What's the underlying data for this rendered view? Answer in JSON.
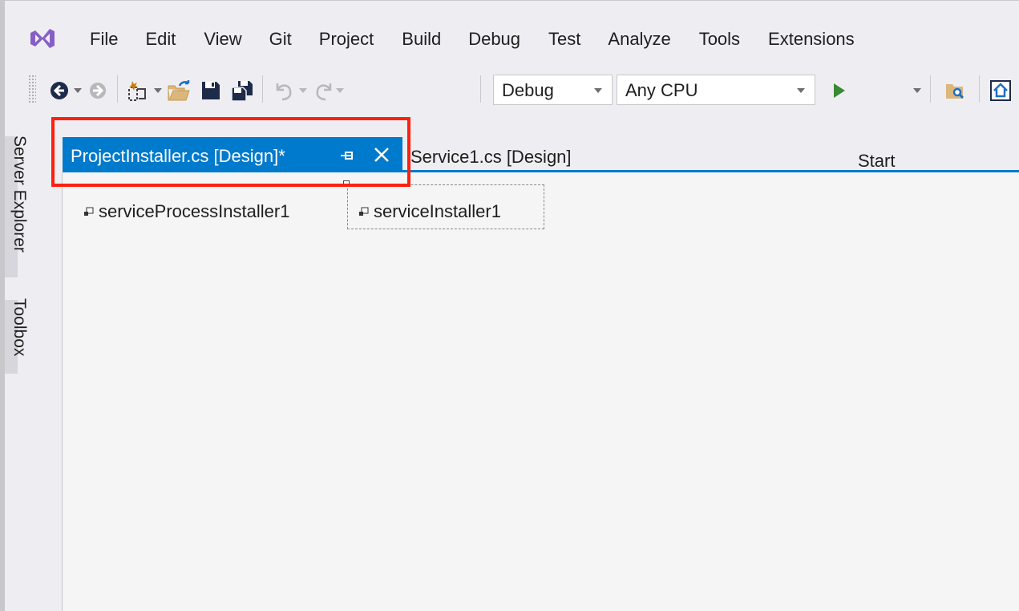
{
  "app": {
    "name": "Visual Studio",
    "logo_icon": "visual-studio-logo-icon",
    "accent_color": "#007acc",
    "highlight_color": "#ff1f0f"
  },
  "menu": {
    "items": [
      "File",
      "Edit",
      "View",
      "Git",
      "Project",
      "Build",
      "Debug",
      "Test",
      "Analyze",
      "Tools",
      "Extensions"
    ]
  },
  "toolbar": {
    "configuration": "Debug",
    "platform": "Any CPU",
    "start_label": "Start",
    "icons": [
      "navigate-back-icon",
      "navigate-forward-icon",
      "new-project-icon",
      "open-file-icon",
      "save-icon",
      "save-all-icon",
      "undo-icon",
      "redo-icon",
      "start-icon",
      "find-in-files-icon",
      "home-icon"
    ]
  },
  "side_panels": [
    "Server Explorer",
    "Toolbox"
  ],
  "tabs": [
    {
      "label": "ProjectInstaller.cs [Design]*",
      "active": true
    },
    {
      "label": "Service1.cs [Design]",
      "active": false
    }
  ],
  "components": [
    {
      "label": "serviceProcessInstaller1",
      "icon": "component-icon",
      "selected": false
    },
    {
      "label": "serviceInstaller1",
      "icon": "component-icon",
      "selected": true
    }
  ]
}
